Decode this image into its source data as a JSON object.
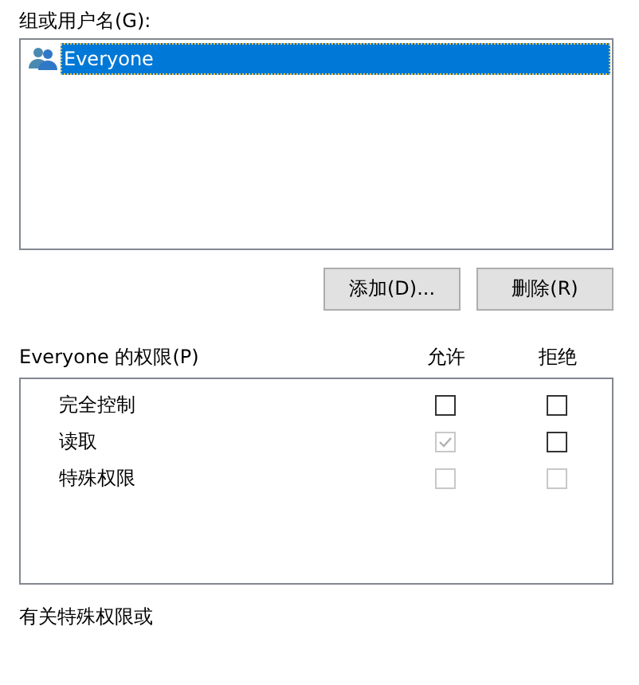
{
  "groups_label": "组或用户名(G):",
  "users": [
    {
      "name": "Everyone",
      "selected": true
    }
  ],
  "buttons": [
    "添加(D)...",
    "删除(R)"
  ],
  "permissions": {
    "title": "Everyone 的权限(P)",
    "allow_header": "允许",
    "deny_header": "拒绝",
    "rows": [
      {
        "name": "完全控制",
        "allow": {
          "checked": false,
          "disabled": false
        },
        "deny": {
          "checked": false,
          "disabled": false
        }
      },
      {
        "name": "读取",
        "allow": {
          "checked": true,
          "disabled": true
        },
        "deny": {
          "checked": false,
          "disabled": false
        }
      },
      {
        "name": "特殊权限",
        "allow": {
          "checked": false,
          "disabled": true
        },
        "deny": {
          "checked": false,
          "disabled": true
        }
      }
    ]
  },
  "footer_text": "有关特殊权限或"
}
